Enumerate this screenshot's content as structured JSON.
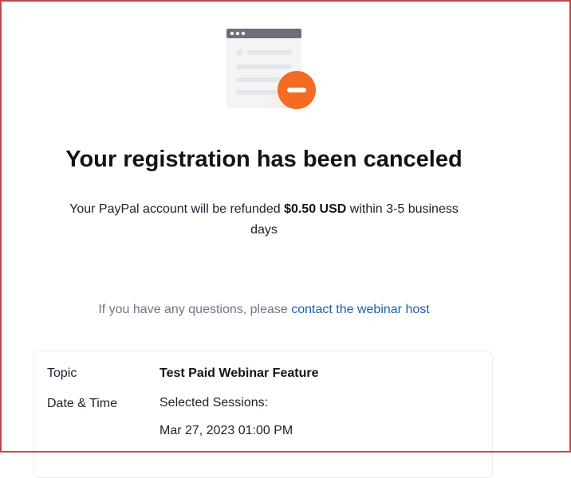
{
  "header": {
    "title": "Your registration has been canceled"
  },
  "refund": {
    "prefix": "Your PayPal account will be refunded ",
    "amount": "$0.50 USD",
    "suffix": " within 3-5 business days"
  },
  "questions": {
    "text": "If you have any questions, please ",
    "link_label": "contact the webinar host"
  },
  "details": {
    "topic_label": "Topic",
    "topic_value": "Test Paid Webinar Feature",
    "datetime_label": "Date & Time",
    "sessions_label": "Selected Sessions:",
    "session_time": "Mar 27, 2023 01:00 PM"
  },
  "colors": {
    "accent_orange": "#f26d22",
    "link_blue": "#1f5fa8",
    "frame_red": "#c0484a"
  },
  "icons": {
    "illustration": "canceled-document-icon"
  }
}
